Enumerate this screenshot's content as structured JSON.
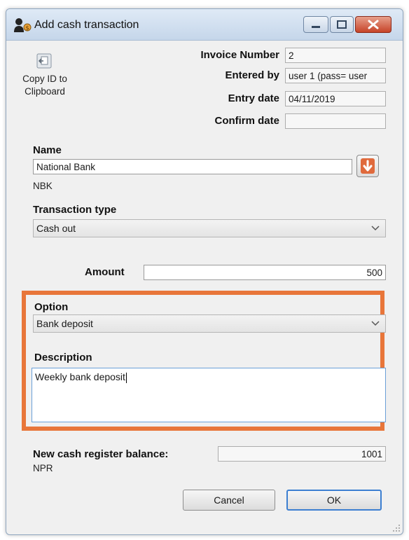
{
  "window": {
    "title": "Add cash transaction",
    "icons": {
      "app": "user-dollar-icon",
      "minimize": "minimize-icon",
      "maximize": "maximize-icon",
      "close": "close-icon"
    }
  },
  "copy_id": {
    "label_line1": "Copy ID to",
    "label_line2": "Clipboard",
    "icon": "clipboard-copy-icon"
  },
  "header": {
    "invoice_number_label": "Invoice Number",
    "invoice_number_value": "2",
    "entered_by_label": "Entered by",
    "entered_by_value": "user 1 (pass= user",
    "entry_date_label": "Entry date",
    "entry_date_value": "04/11/2019",
    "confirm_date_label": "Confirm date",
    "confirm_date_value": ""
  },
  "name": {
    "label": "Name",
    "value": "National Bank",
    "code": "NBK",
    "icon": "arrow-down-icon"
  },
  "transaction_type": {
    "label": "Transaction type",
    "selected": "Cash out"
  },
  "amount": {
    "label": "Amount",
    "value": "500"
  },
  "option": {
    "label": "Option",
    "selected": "Bank deposit"
  },
  "description": {
    "label": "Description",
    "value": "Weekly bank deposit"
  },
  "balance": {
    "label": "New cash register balance:",
    "value": "1001",
    "currency": "NPR"
  },
  "buttons": {
    "cancel": "Cancel",
    "ok": "OK"
  },
  "colors": {
    "highlight": "#e8763a",
    "title_bar": "#c5d6ea",
    "close_button": "#c64328",
    "down_button": "#e06a3c"
  }
}
